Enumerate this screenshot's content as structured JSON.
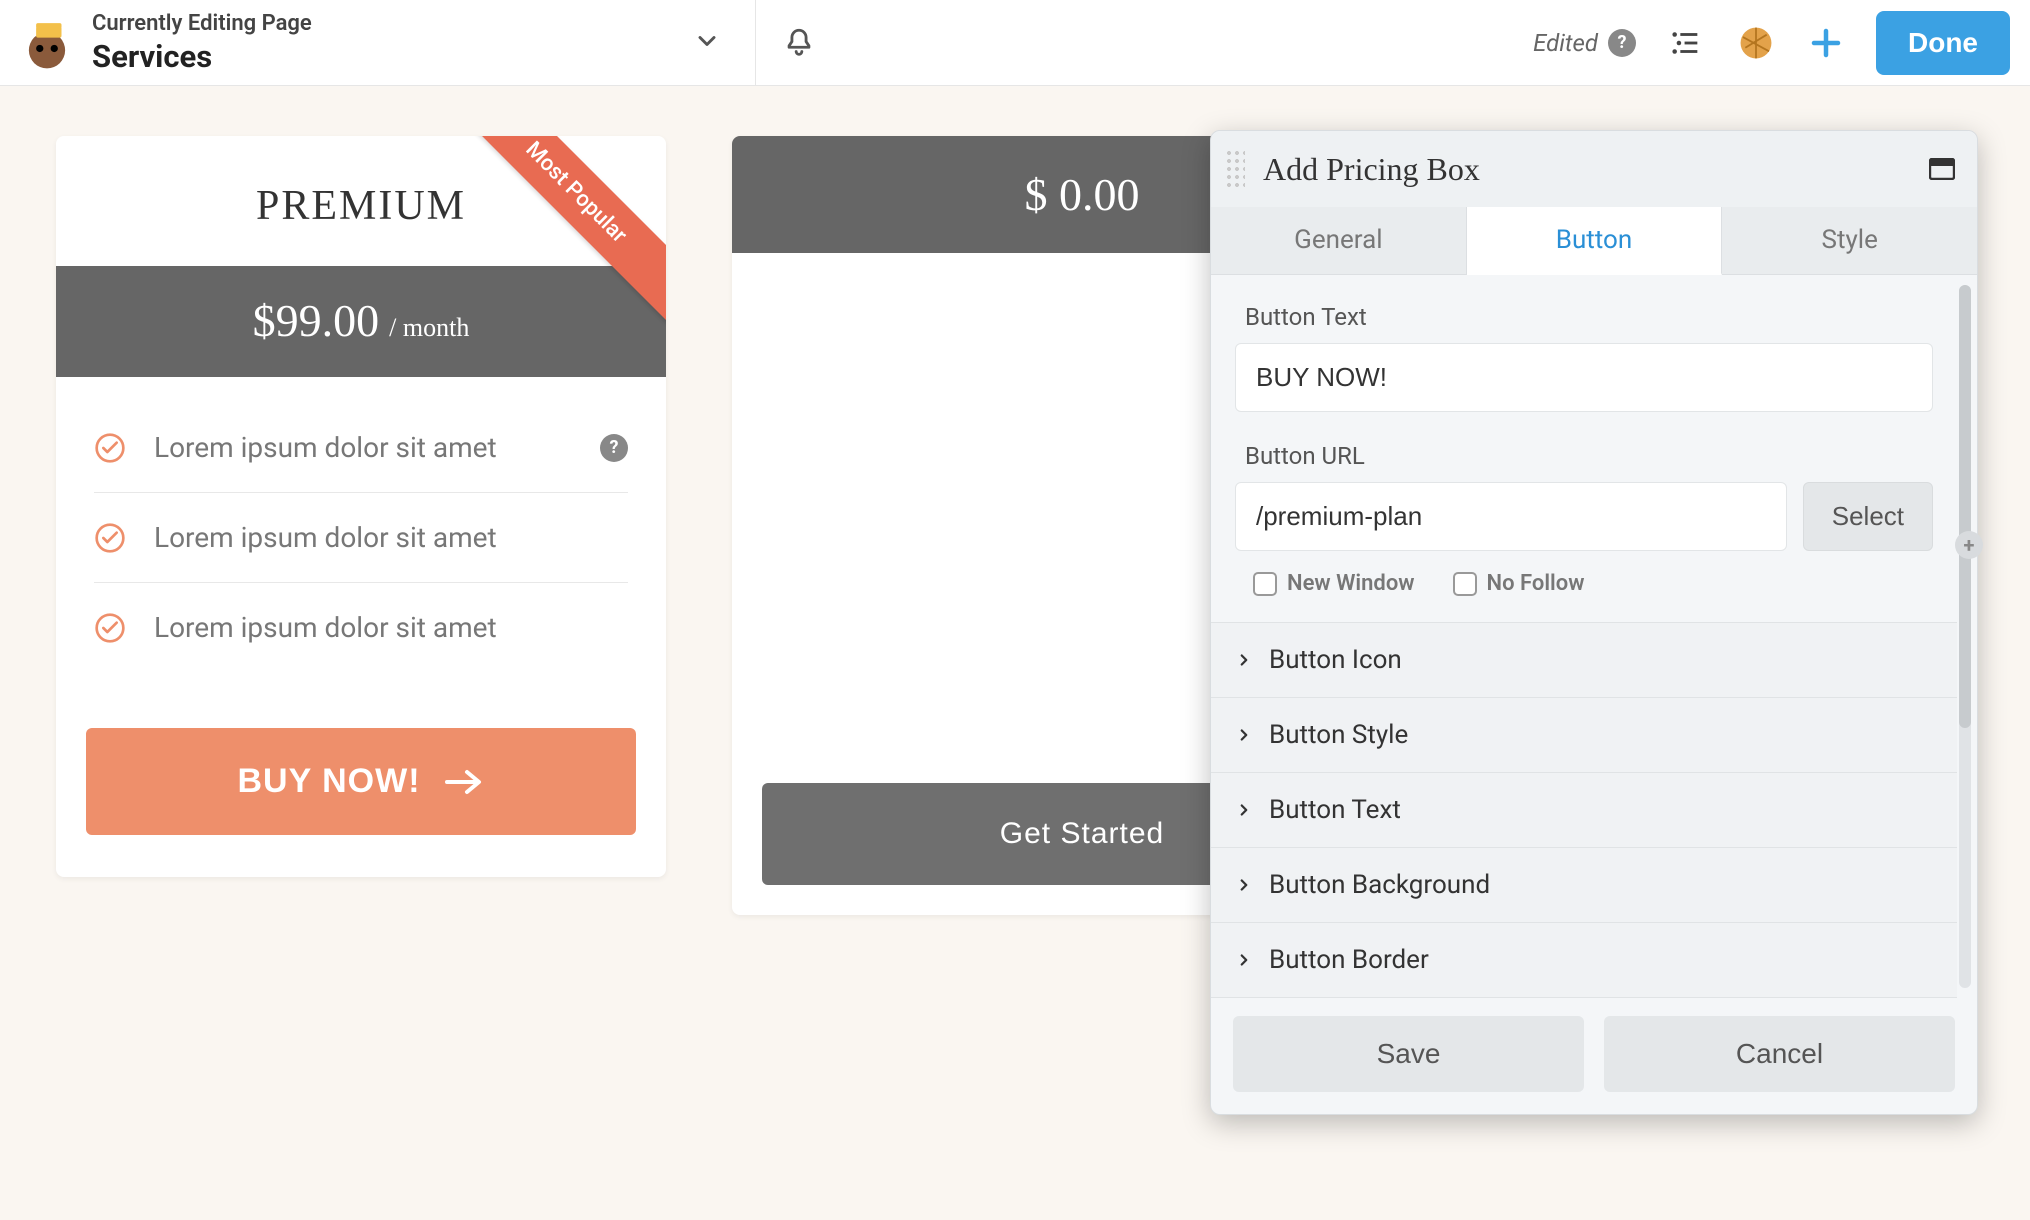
{
  "topbar": {
    "overline": "Currently Editing Page",
    "title": "Services",
    "edited_label": "Edited",
    "done_label": "Done"
  },
  "cards": {
    "premium": {
      "ribbon": "Most Popular",
      "name": "PREMIUM",
      "price": "$99.00",
      "period": "/ month",
      "features": [
        "Lorem ipsum dolor sit amet",
        "Lorem ipsum dolor sit amet",
        "Lorem ipsum dolor sit amet"
      ],
      "cta": "BUY NOW!"
    },
    "simple": {
      "price": "$ 0.00",
      "cta": "Get Started"
    }
  },
  "panel": {
    "title": "Add Pricing Box",
    "tabs": {
      "general": "General",
      "button": "Button",
      "style": "Style",
      "active": "button"
    },
    "fields": {
      "button_text_label": "Button Text",
      "button_text_value": "BUY NOW!",
      "button_url_label": "Button URL",
      "button_url_value": "/premium-plan",
      "select_label": "Select",
      "new_window_label": "New Window",
      "no_follow_label": "No Follow"
    },
    "accordion": [
      "Button Icon",
      "Button Style",
      "Button Text",
      "Button Background",
      "Button Border"
    ],
    "footer": {
      "save": "Save",
      "cancel": "Cancel"
    }
  }
}
